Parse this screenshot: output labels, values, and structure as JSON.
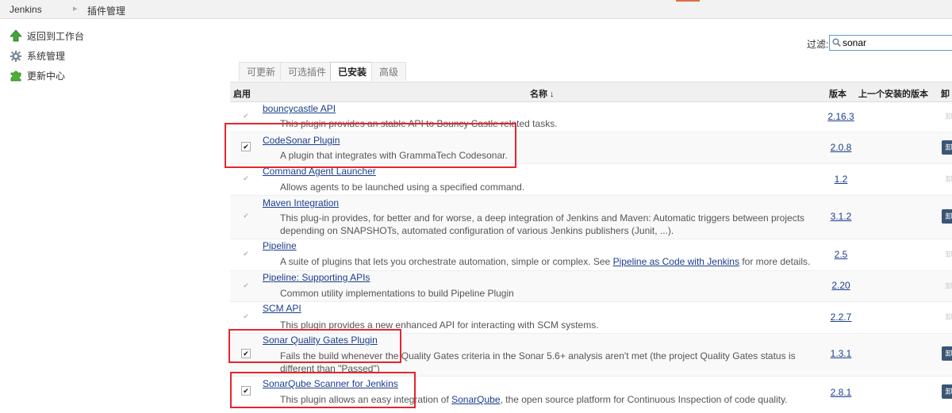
{
  "breadcrumb": {
    "home": "Jenkins",
    "current": "插件管理"
  },
  "sidebar": {
    "items": [
      {
        "label": "返回到工作台",
        "icon": "up-arrow-icon"
      },
      {
        "label": "系统管理",
        "icon": "gear-icon"
      },
      {
        "label": "更新中心",
        "icon": "puzzle-icon"
      }
    ]
  },
  "filter": {
    "label": "过滤:",
    "value": "sonar"
  },
  "tabs": [
    {
      "label": "可更新"
    },
    {
      "label": "可选插件"
    },
    {
      "label": "已安装",
      "active": true
    },
    {
      "label": "高级"
    }
  ],
  "table": {
    "headers": {
      "enabled": "启用",
      "name": "名称 ↓",
      "version": "版本",
      "previous": "上一个安装的版本",
      "uninstall": "卸"
    },
    "rows": [
      {
        "name": "bouncycastle API",
        "desc": "This plugin provides an stable API to Bouncy Castle related tasks.",
        "version": "2.16.3",
        "checked": false,
        "uninstall": "卸"
      },
      {
        "name": "CodeSonar Plugin",
        "desc": "A plugin that integrates with GrammaTech Codesonar.",
        "version": "2.0.8",
        "checked": true,
        "uninstall": "卸"
      },
      {
        "name": "Command Agent Launcher",
        "desc": "Allows agents to be launched using a specified command.",
        "version": "1.2",
        "checked": false,
        "uninstall": "卸"
      },
      {
        "name": "Maven Integration",
        "desc": "This plug-in provides, for better and for worse, a deep integration of Jenkins and Maven: Automatic triggers between projects depending on SNAPSHOTs, automated configuration of various Jenkins publishers (Junit, ...).",
        "version": "3.1.2",
        "checked": false,
        "uninstall": "卸"
      },
      {
        "name": "Pipeline",
        "desc_pre": "A suite of plugins that lets you orchestrate automation, simple or complex. See ",
        "desc_link": "Pipeline as Code with Jenkins",
        "desc_post": " for more details.",
        "version": "2.5",
        "checked": false,
        "uninstall": "卸"
      },
      {
        "name": "Pipeline: Supporting APIs",
        "desc": "Common utility implementations to build Pipeline Plugin",
        "version": "2.20",
        "checked": false,
        "uninstall": "卸"
      },
      {
        "name": "SCM API",
        "desc": "This plugin provides a new enhanced API for interacting with SCM systems.",
        "version": "2.2.7",
        "checked": false,
        "uninstall": "卸"
      },
      {
        "name": "Sonar Quality Gates Plugin",
        "desc": "Fails the build whenever the Quality Gates criteria in the Sonar 5.6+ analysis aren't met (the project Quality Gates status is different than \"Passed\")",
        "version": "1.3.1",
        "checked": true,
        "uninstall": "卸"
      },
      {
        "name": "SonarQube Scanner for Jenkins",
        "desc_pre": "This plugin allows an easy integration of ",
        "desc_link": "SonarQube",
        "desc_post": ", the open source platform for Continuous Inspection of code quality.",
        "version": "2.8.1",
        "checked": true,
        "uninstall": "卸"
      }
    ]
  },
  "colors": {
    "highlight_box": "#e3262e",
    "link": "#1c3d8d",
    "uninstall_button": "#3a5575"
  }
}
